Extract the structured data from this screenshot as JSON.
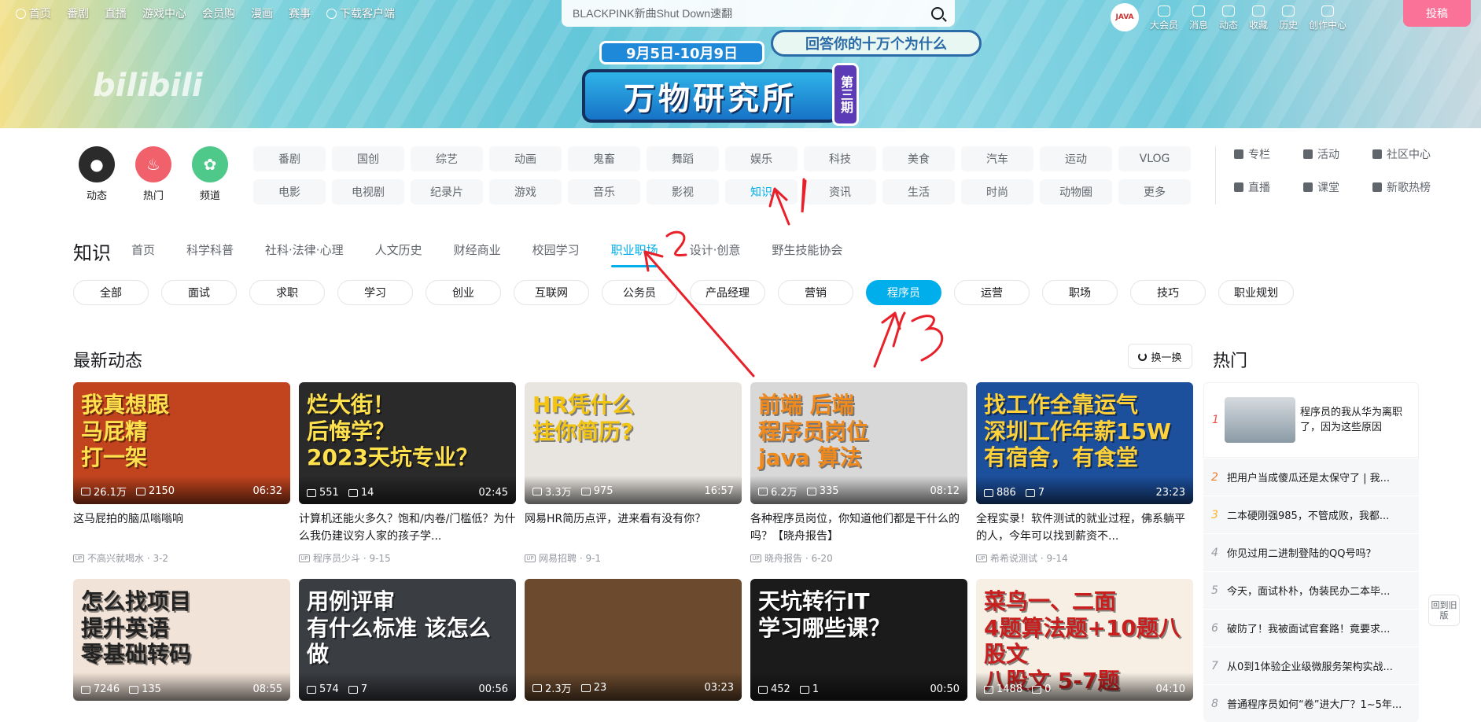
{
  "topnav": {
    "items": [
      "首页",
      "番剧",
      "直播",
      "游戏中心",
      "会员购",
      "漫画",
      "赛事"
    ],
    "download": "下载客户端"
  },
  "search": {
    "value": "BLACKPINK新曲Shut Down速翻"
  },
  "user": {
    "avatar_text": "JAVA",
    "items": [
      "大会员",
      "消息",
      "动态",
      "收藏",
      "历史",
      "创作中心"
    ],
    "upload": "投稿"
  },
  "banner": {
    "logo": "bilibili",
    "date": "9月5日-10月9日",
    "question": "回答你的十万个为什么",
    "title": "万物研究所",
    "issue": "第三期"
  },
  "quick": [
    {
      "label": "动态",
      "color": "#2b2b2b",
      "icon": "user-avatar"
    },
    {
      "label": "热门",
      "color": "#f0616c",
      "icon": "fire"
    },
    {
      "label": "频道",
      "color": "#4fc98a",
      "icon": "channels"
    }
  ],
  "categories": [
    "番剧",
    "国创",
    "综艺",
    "动画",
    "鬼畜",
    "舞蹈",
    "娱乐",
    "科技",
    "美食",
    "汽车",
    "运动",
    "VLOG",
    "电影",
    "电视剧",
    "纪录片",
    "游戏",
    "音乐",
    "影视",
    "知识",
    "资讯",
    "生活",
    "时尚",
    "动物圈",
    "更多"
  ],
  "active_category": "知识",
  "side_links": [
    "专栏",
    "活动",
    "社区中心",
    "直播",
    "课堂",
    "新歌热榜"
  ],
  "subnav": {
    "title": "知识",
    "items": [
      "首页",
      "科学科普",
      "社科·法律·心理",
      "人文历史",
      "财经商业",
      "校园学习",
      "职业职场",
      "设计·创意",
      "野生技能协会"
    ],
    "active": "职业职场"
  },
  "tags": {
    "items": [
      "全部",
      "面试",
      "求职",
      "学习",
      "创业",
      "互联网",
      "公务员",
      "产品经理",
      "营销",
      "程序员",
      "运营",
      "职场",
      "技巧",
      "职业规划"
    ],
    "active": "程序员"
  },
  "section": {
    "title": "最新动态",
    "refresh": "换一换",
    "hot_title": "热门"
  },
  "videos": [
    {
      "thumb_text": "我真想跟\n马屁精\n打一架",
      "bg": "#c2441e",
      "fg": "#ffe14d",
      "plays": "26.1万",
      "danmaku": "2150",
      "duration": "06:32",
      "title": "这马屁拍的脑瓜嗡嗡响",
      "up": "不高兴就喝水",
      "date": "3-2"
    },
    {
      "thumb_text": "烂大街！\n后悔学？\n2023天坑专业？",
      "bg": "#2a2a2a",
      "fg": "#ffe14d",
      "plays": "551",
      "danmaku": "14",
      "duration": "02:45",
      "title": "计算机还能火多久？饱和/内卷/门槛低？为什么我仍建议穷人家的孩子学...",
      "up": "程序员少斗",
      "date": "9-15"
    },
    {
      "thumb_text": "HR凭什么\n挂你简历?",
      "bg": "#e8e4df",
      "fg": "#f3c512",
      "plays": "3.3万",
      "danmaku": "975",
      "duration": "16:57",
      "title": "网易HR简历点评，进来看有没有你？",
      "up": "网易招聘",
      "date": "9-1"
    },
    {
      "thumb_text": "前端 后端\n程序员岗位\njava 算法",
      "bg": "#d8d8d8",
      "fg": "#f08a1c",
      "plays": "6.2万",
      "danmaku": "335",
      "duration": "08:12",
      "title": "各种程序员岗位，你知道他们都是干什么的吗？【晓舟报告】",
      "up": "晓舟报告",
      "date": "6-20"
    },
    {
      "thumb_text": "找工作全靠运气\n深圳工作年薪15W\n有宿舍，有食堂",
      "bg": "#1c4f9c",
      "fg": "#ffd23c",
      "plays": "886",
      "danmaku": "7",
      "duration": "23:23",
      "title": "全程实录！软件测试的就业过程，佛系躺平的人，今年可以找到薪资不...",
      "up": "希希说测试",
      "date": "9-14"
    },
    {
      "thumb_text": "怎么找项目\n提升英语\n零基础转码",
      "bg": "#f2e3d8",
      "fg": "#222222",
      "plays": "7246",
      "danmaku": "135",
      "duration": "08:55",
      "title": "",
      "up": "",
      "date": ""
    },
    {
      "thumb_text": "用例评审\n有什么标准 该怎么做",
      "bg": "#3a3d42",
      "fg": "#ffffff",
      "plays": "574",
      "danmaku": "7",
      "duration": "00:56",
      "title": "",
      "up": "",
      "date": ""
    },
    {
      "thumb_text": "",
      "bg": "#6b4a2e",
      "fg": "#ffffff",
      "plays": "2.3万",
      "danmaku": "23",
      "duration": "03:23",
      "title": "",
      "up": "",
      "date": ""
    },
    {
      "thumb_text": "天坑转行IT\n学习哪些课？",
      "bg": "#1b1b1b",
      "fg": "#ffffff",
      "plays": "452",
      "danmaku": "1",
      "duration": "00:50",
      "title": "",
      "up": "",
      "date": ""
    },
    {
      "thumb_text": "菜鸟一、二面\n4题算法题+10题八股文\n八股文 5-7题",
      "bg": "#f7efe4",
      "fg": "#c81e1e",
      "plays": "1488",
      "danmaku": "0",
      "duration": "04:10",
      "title": "",
      "up": "",
      "date": ""
    }
  ],
  "hot": [
    {
      "rank": "1",
      "title": "程序员的我从华为离职了，因为这些原因"
    },
    {
      "rank": "2",
      "title": "把用户当成傻瓜还是太保守了 | 我..."
    },
    {
      "rank": "3",
      "title": "二本硬刚强985，不管成败，我都..."
    },
    {
      "rank": "4",
      "title": "你见过用二进制登陆的QQ号吗？"
    },
    {
      "rank": "5",
      "title": "今天，面试朴朴，伪装民办二本毕..."
    },
    {
      "rank": "6",
      "title": "破防了！我被面试官套路！竟要求..."
    },
    {
      "rank": "7",
      "title": "从0到1体验企业级微服务架构实战..."
    },
    {
      "rank": "8",
      "title": "普通程序员如何“卷”进大厂？1~5年..."
    }
  ],
  "rank_colors": {
    "1": "#f04c49",
    "2": "#f07f2a",
    "3": "#ffb027"
  },
  "back_old": "回到旧版",
  "annotations": [
    "1",
    "2",
    "3"
  ]
}
